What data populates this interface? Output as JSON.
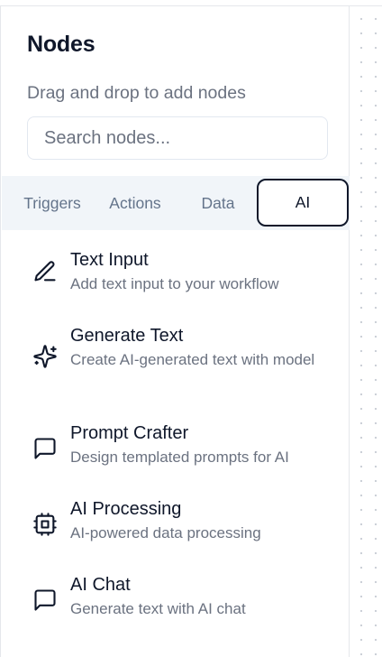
{
  "panel": {
    "title": "Nodes",
    "subtitle": "Drag and drop to add nodes",
    "search_placeholder": "Search nodes..."
  },
  "tabs": [
    {
      "label": "Triggers",
      "active": false
    },
    {
      "label": "Actions",
      "active": false
    },
    {
      "label": "Data",
      "active": false
    },
    {
      "label": "AI",
      "active": true
    }
  ],
  "nodes": [
    {
      "name": "Text Input",
      "description": "Add text input to your workflow",
      "icon": "pencil-icon"
    },
    {
      "name": "Generate Text",
      "description": "Create AI-generated text with model",
      "icon": "sparkles-icon"
    },
    {
      "name": "Prompt Crafter",
      "description": "Design templated prompts for AI",
      "icon": "message-square-icon"
    },
    {
      "name": "AI Processing",
      "description": "AI-powered data processing",
      "icon": "cpu-icon"
    },
    {
      "name": "AI Chat",
      "description": "Generate text with AI chat",
      "icon": "message-square-icon"
    }
  ],
  "colors": {
    "text_primary": "#0f172a",
    "text_muted": "#6b7280",
    "tab_bg": "#f1f5f9",
    "border": "#e5e7eb"
  }
}
